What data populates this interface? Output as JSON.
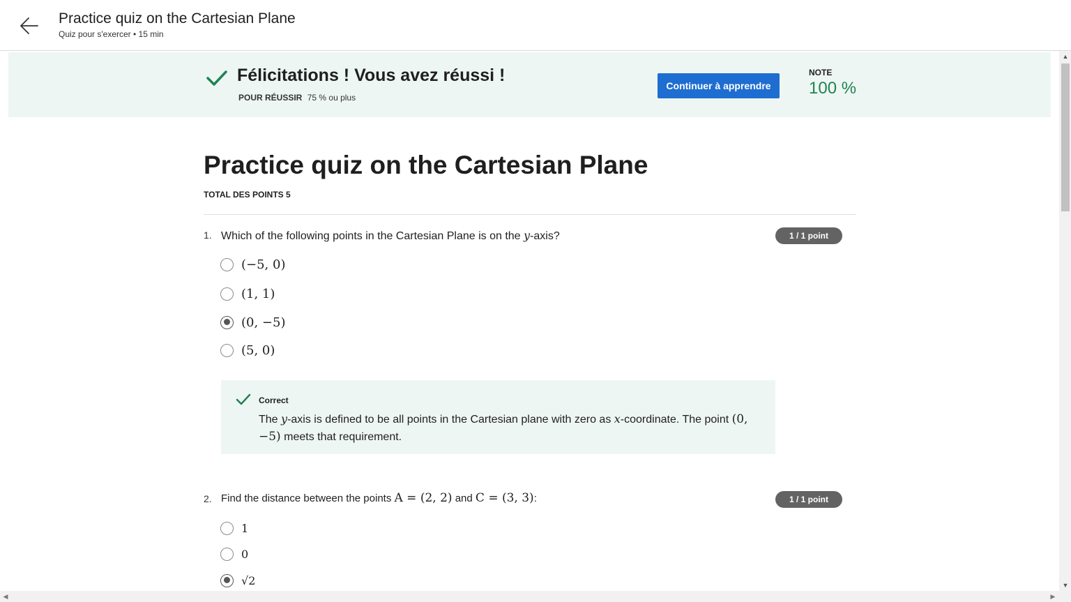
{
  "header": {
    "title": "Practice quiz on the Cartesian Plane",
    "subtitle": "Quiz pour s'exercer • 15  min"
  },
  "banner": {
    "title": "Félicitations ! Vous avez réussi !",
    "pass_label": "POUR RÉUSSIR",
    "pass_value": "75 % ou plus",
    "continue_label": "Continuer à apprendre",
    "grade_label": "NOTE",
    "grade_value": "100 %",
    "accent_color": "#1f8354",
    "button_color": "#1e6dd1"
  },
  "quiz": {
    "title": "Practice quiz on the Cartesian Plane",
    "total_points": "TOTAL DES POINTS 5"
  },
  "questions": [
    {
      "number": "1.",
      "text_before": "Which of the following points in the Cartesian Plane is on the ",
      "text_math": "y",
      "text_after": "-axis?",
      "badge": "1 / 1 point",
      "options": [
        {
          "label": "(−5, 0)",
          "selected": false
        },
        {
          "label": "(1, 1)",
          "selected": false
        },
        {
          "label": "(0, −5)",
          "selected": true
        },
        {
          "label": "(5, 0)",
          "selected": false
        }
      ],
      "feedback": {
        "label": "Correct",
        "part1": "The ",
        "math1": "y",
        "part2": "-axis is defined to be all points in the Cartesian plane with zero as ",
        "math2": "x",
        "part3": "-coordinate. The point ",
        "math3": "(0, −5)",
        "part4": " meets that requirement."
      }
    },
    {
      "number": "2.",
      "text_before": "Find the distance between the points ",
      "math_a": "A = (2, 2)",
      "text_mid": " and ",
      "math_c": "C = (3, 3)",
      "text_after": ":",
      "badge": "1 / 1 point",
      "options": [
        {
          "label": "1",
          "selected": false
        },
        {
          "label": "0",
          "selected": false
        },
        {
          "label": "√2",
          "selected": true
        }
      ]
    }
  ]
}
